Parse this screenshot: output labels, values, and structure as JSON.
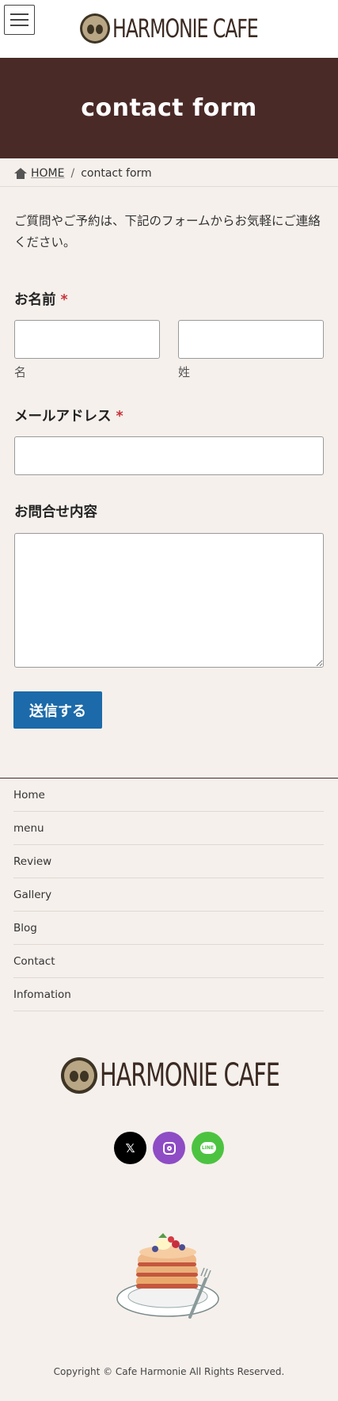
{
  "header": {
    "menu_icon": "hamburger-icon",
    "logo_text": "HARMONIE CAFE",
    "logo_badge_text": "Harmonie Cafe"
  },
  "hero": {
    "title": "contact form"
  },
  "breadcrumb": {
    "home": "HOME",
    "separator": "/",
    "current": "contact form"
  },
  "intro": "ご質問やご予約は、下記のフォームからお気軽にご連絡ください。",
  "form": {
    "name_label": "お名前",
    "required_mark": "*",
    "first_name_value": "",
    "last_name_value": "",
    "first_name_sublabel": "名",
    "last_name_sublabel": "姓",
    "email_label": "メールアドレス",
    "email_value": "",
    "message_label": "お問合せ内容",
    "message_value": "",
    "submit_label": "送信する"
  },
  "footer": {
    "nav": [
      "Home",
      "menu",
      "Review",
      "Gallery",
      "Blog",
      "Contact",
      "Infomation"
    ],
    "logo_text": "HARMONIE CAFE",
    "social": [
      {
        "name": "x-icon",
        "glyph": "𝕏"
      },
      {
        "name": "instagram-icon"
      },
      {
        "name": "line-icon",
        "glyph": "LINE"
      }
    ],
    "copyright": "Copyright © Cafe Harmonie All Rights Reserved."
  },
  "colors": {
    "hero_bg": "#4a2a27",
    "page_bg": "#f5f0ec",
    "button_bg": "#1c6aa9",
    "required": "#c7333a"
  }
}
